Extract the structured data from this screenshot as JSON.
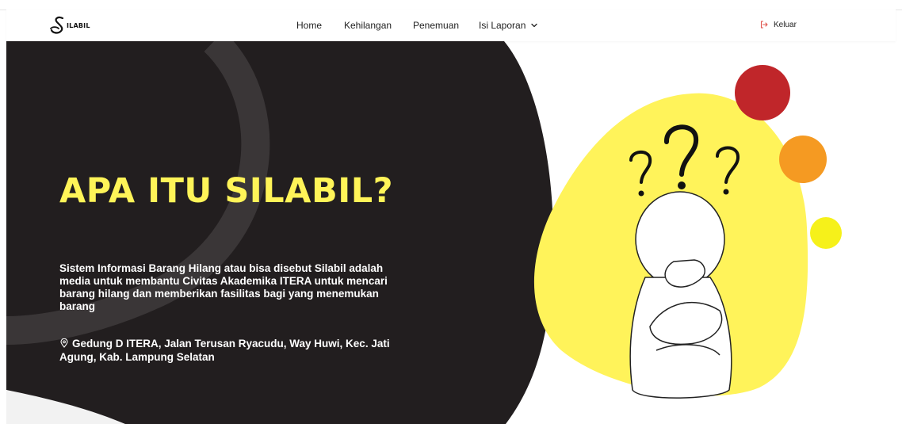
{
  "navbar": {
    "logo_text": "ILABIL",
    "links": [
      "Home",
      "Kehilangan",
      "Penemuan",
      "Isi Laporan"
    ],
    "logout_label": "Keluar"
  },
  "hero": {
    "headline": "APA ITU SILABIL?",
    "description": "Sistem Informasi Barang Hilang atau bisa disebut Silabil adalah media untuk membantu Civitas Akademika ITERA untuk mencari barang hilang dan memberikan fasilitas bagi yang menemukan barang",
    "address": "Gedung D ITERA, Jalan Terusan Ryacudu, Way Huwi, Kec. Jati Agung, Kab. Lampung Selatan"
  },
  "colors": {
    "dark": "#221E1F",
    "headline_yellow": "#FFF458",
    "blob_yellow": "#FFF35A",
    "red": "#C0262A",
    "orange": "#F59A22",
    "bright_yellow": "#F6F11A",
    "logout_icon": "#E0564F"
  },
  "icons": {
    "logo": "silabil-logo",
    "dropdown": "chevron-down-icon",
    "logout": "logout-icon",
    "address": "location-pin-icon"
  }
}
